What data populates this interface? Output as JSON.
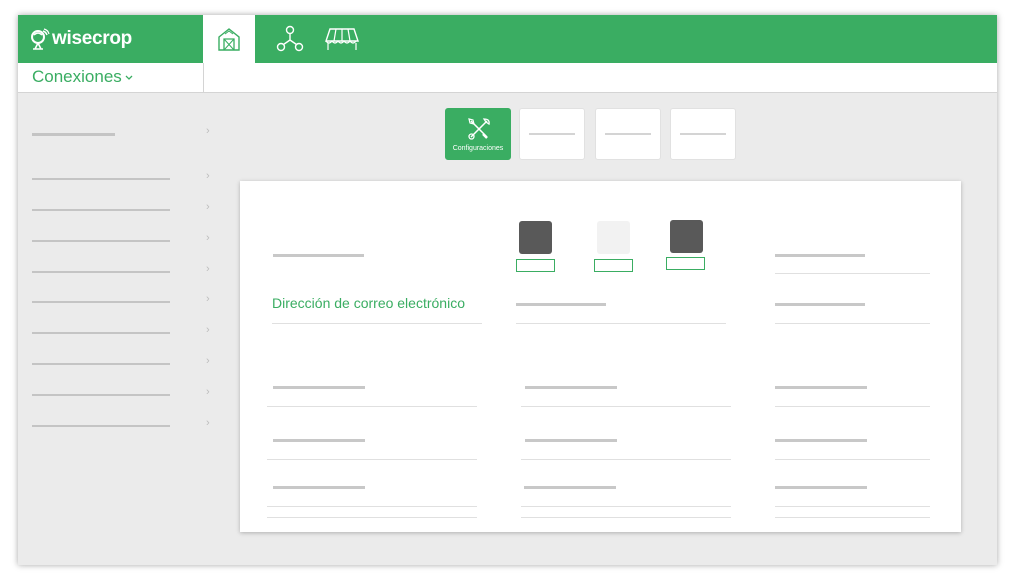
{
  "app": {
    "brand": "wisecrop",
    "section_title": "Conexiones"
  },
  "nav": {
    "tabs": [
      {
        "icon": "farm-house-icon",
        "active": true
      },
      {
        "icon": "network-nodes-icon",
        "active": false
      },
      {
        "icon": "greenhouse-icon",
        "active": false
      }
    ]
  },
  "toolbar": {
    "configurations_label": "Configuraciones"
  },
  "form": {
    "email_label": "Dirección de correo electrónico"
  },
  "colors": {
    "accent": "#3aad62",
    "placeholder": "#c8c8c8",
    "dark_swatch": "#595959",
    "light_swatch": "#f2f2f2"
  }
}
